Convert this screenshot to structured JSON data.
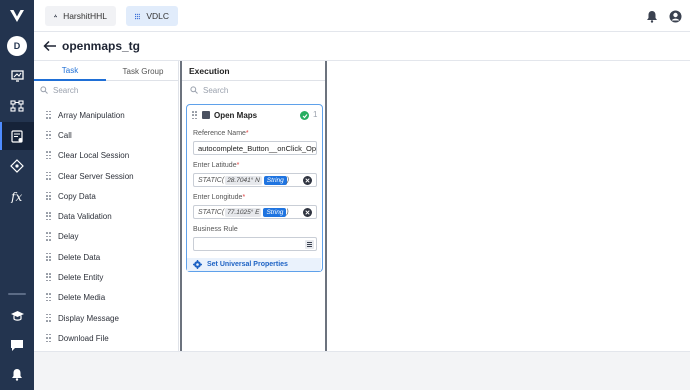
{
  "user_initial": "D",
  "org_tab": {
    "label": "HarshitHHL"
  },
  "app_tab": {
    "label": "VDLC"
  },
  "page": {
    "title": "openmaps_tg"
  },
  "task_panel": {
    "tabs": [
      {
        "label": "Task",
        "active": true
      },
      {
        "label": "Task Group",
        "active": false
      }
    ],
    "search_placeholder": "Search",
    "tasks": [
      "Array Manipulation",
      "Call",
      "Clear Local Session",
      "Clear Server Session",
      "Copy Data",
      "Data Validation",
      "Delay",
      "Delete Data",
      "Delete Entity",
      "Delete Media",
      "Display Message",
      "Download File"
    ]
  },
  "execution": {
    "title": "Execution",
    "search_placeholder": "Search",
    "card": {
      "title": "Open Maps",
      "count": "1",
      "reference_label": "Reference Name",
      "reference_value": "autocomplete_Button__onClick_Ope",
      "latitude_label": "Enter Latitude",
      "latitude_prefix": "STATIC(",
      "latitude_value": "28.7041° N",
      "latitude_type": "String",
      "latitude_suffix": ")",
      "longitude_label": "Enter Longitude",
      "longitude_prefix": "STATIC(",
      "longitude_value": "77.1025° E",
      "longitude_type": "String",
      "longitude_suffix": ")",
      "business_rule_label": "Business Rule",
      "business_rule_value": "",
      "universal_label": "Set Universal Properties"
    }
  },
  "colors": {
    "rail": "#23344f",
    "accent": "#1f74e0",
    "success": "#27ae60"
  }
}
